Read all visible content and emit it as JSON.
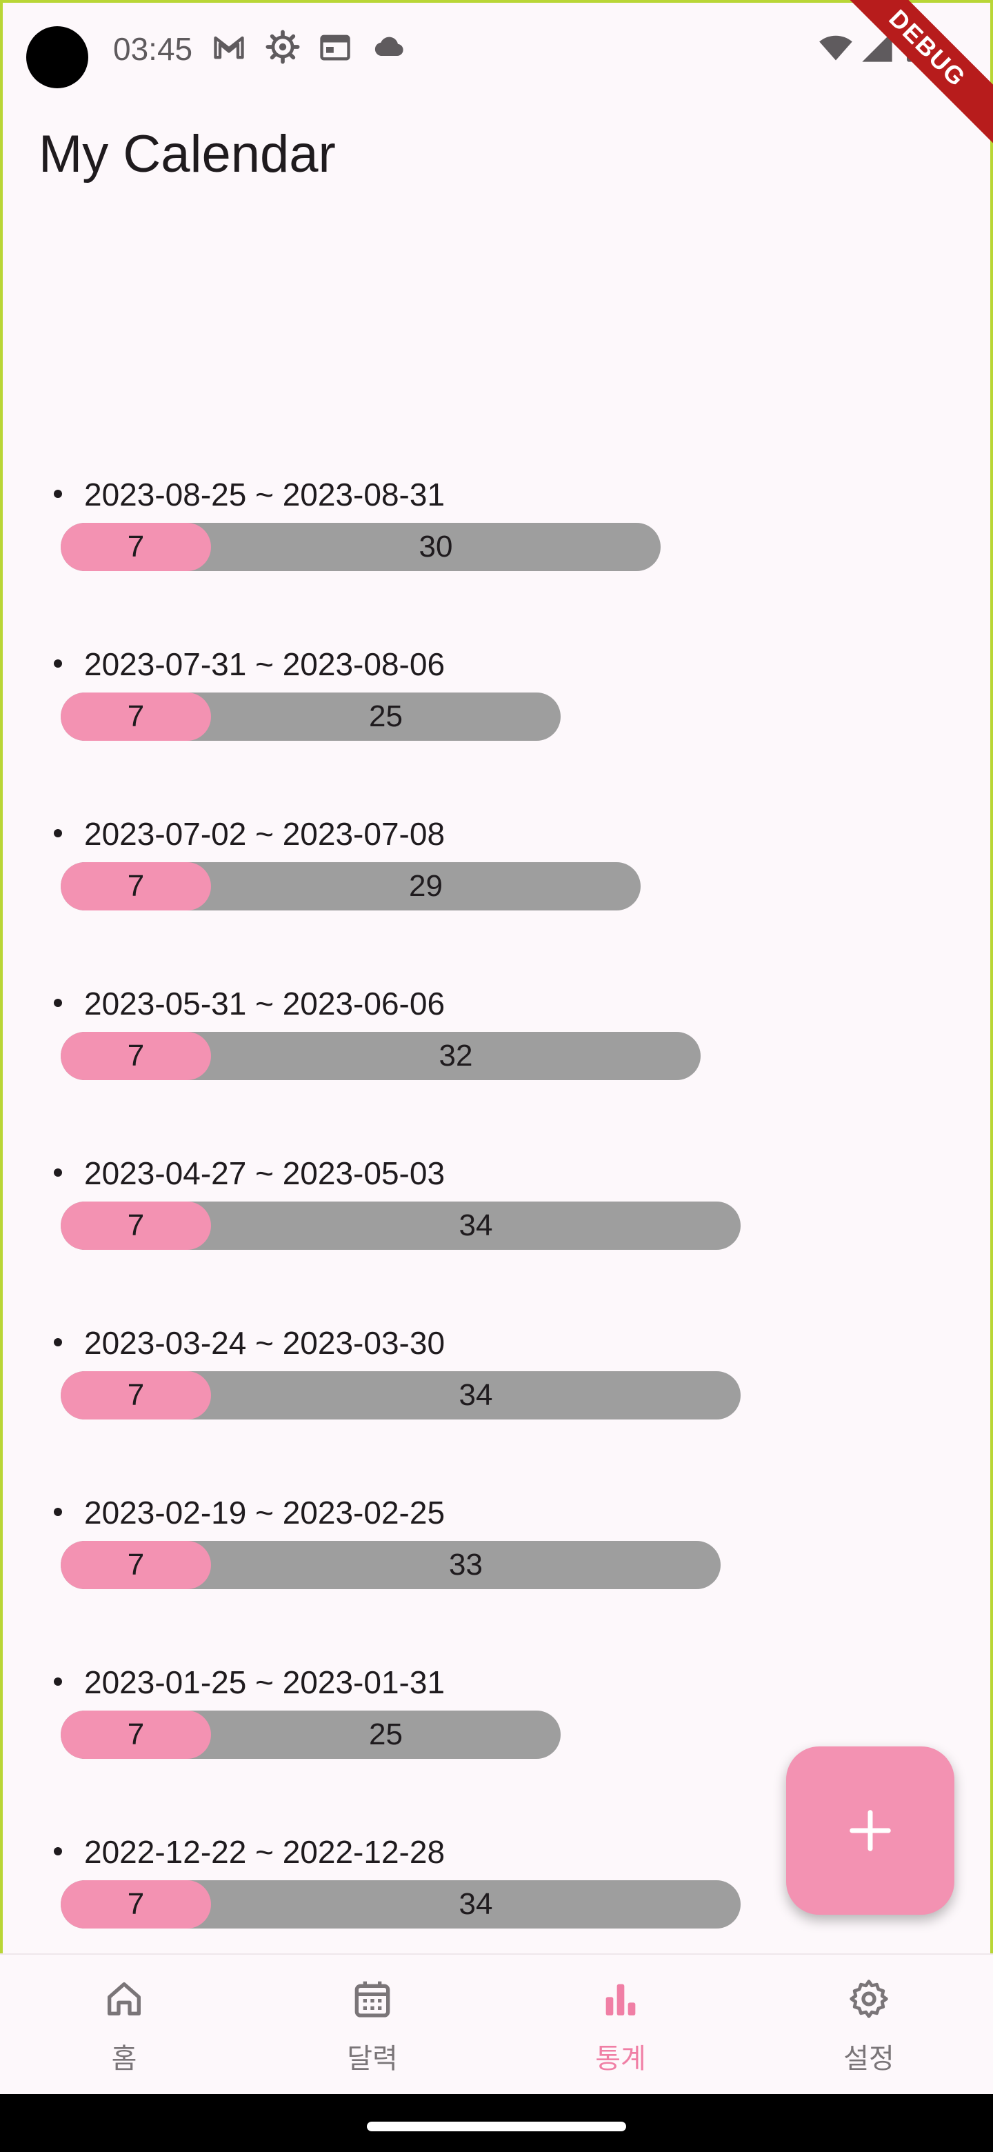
{
  "status_bar": {
    "time": "03:45",
    "icons": [
      "gmail-icon",
      "settings-icon",
      "calendar-icon",
      "cloud-icon",
      "wifi-icon",
      "signal-icon",
      "battery-icon"
    ],
    "debug_label": "DEBUG"
  },
  "app": {
    "title": "My Calendar",
    "accent": "#f392b2",
    "bar_base": "#9e9e9e"
  },
  "periods": [
    {
      "range": "2023-08-25 ~ 2023-08-31",
      "period_days": "7",
      "cycle_days": "30"
    },
    {
      "range": "2023-07-31 ~ 2023-08-06",
      "period_days": "7",
      "cycle_days": "25"
    },
    {
      "range": "2023-07-02 ~ 2023-07-08",
      "period_days": "7",
      "cycle_days": "29"
    },
    {
      "range": "2023-05-31 ~ 2023-06-06",
      "period_days": "7",
      "cycle_days": "32"
    },
    {
      "range": "2023-04-27 ~ 2023-05-03",
      "period_days": "7",
      "cycle_days": "34"
    },
    {
      "range": "2023-03-24 ~ 2023-03-30",
      "period_days": "7",
      "cycle_days": "34"
    },
    {
      "range": "2023-02-19 ~ 2023-02-25",
      "period_days": "7",
      "cycle_days": "33"
    },
    {
      "range": "2023-01-25 ~ 2023-01-31",
      "period_days": "7",
      "cycle_days": "25"
    },
    {
      "range": "2022-12-22 ~ 2022-12-28",
      "period_days": "7",
      "cycle_days": "34"
    }
  ],
  "fab": {
    "icon": "plus-icon"
  },
  "nav": {
    "items": [
      {
        "label": "홈",
        "icon": "home-icon",
        "active": false
      },
      {
        "label": "달력",
        "icon": "calendar-icon",
        "active": false
      },
      {
        "label": "통계",
        "icon": "bar-chart-icon",
        "active": true
      },
      {
        "label": "설정",
        "icon": "settings-icon",
        "active": false
      }
    ]
  }
}
